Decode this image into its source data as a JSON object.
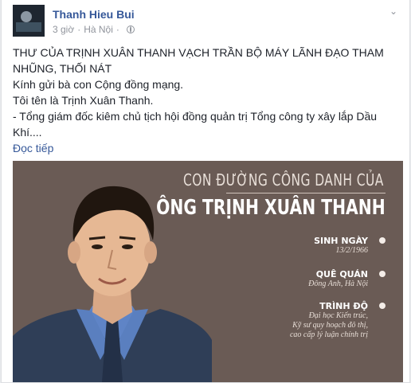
{
  "post": {
    "author": "Thanh Hieu Bui",
    "time": "3 giờ",
    "location": "Hà Nội",
    "options_icon": "chevron-down-icon",
    "lines": [
      "THƯ CỦA TRỊNH XUÂN THANH VẠCH TRẦN BỘ MÁY LÃNH ĐẠO THAM NHŨNG, THỐI NÁT",
      "Kính gửi bà con Cộng đồng mạng.",
      "Tôi tên là Trịnh Xuân Thanh.",
      "- Tổng giám đốc kiêm chủ tịch hội đồng quản trị Tổng công ty xây lắp Dầu Khí...."
    ],
    "see_more": "Đọc tiếp"
  },
  "infographic": {
    "heading_small": "CON ĐƯỜNG CÔNG DANH CỦA",
    "heading_large": "ÔNG TRỊNH XUÂN THANH",
    "facts": [
      {
        "label": "SINH NGÀY",
        "value": [
          "13/2/1966"
        ]
      },
      {
        "label": "QUÊ QUÁN",
        "value": [
          "Đông Anh, Hà Nội"
        ]
      },
      {
        "label": "TRÌNH ĐỘ",
        "value": [
          "Đại học Kiến trúc,",
          "Kỹ sư quy hoạch đô thị,",
          "cao cấp lý luận chính trị"
        ]
      }
    ]
  },
  "colors": {
    "link": "#365899",
    "infographic_bg": "#6a5b55"
  }
}
